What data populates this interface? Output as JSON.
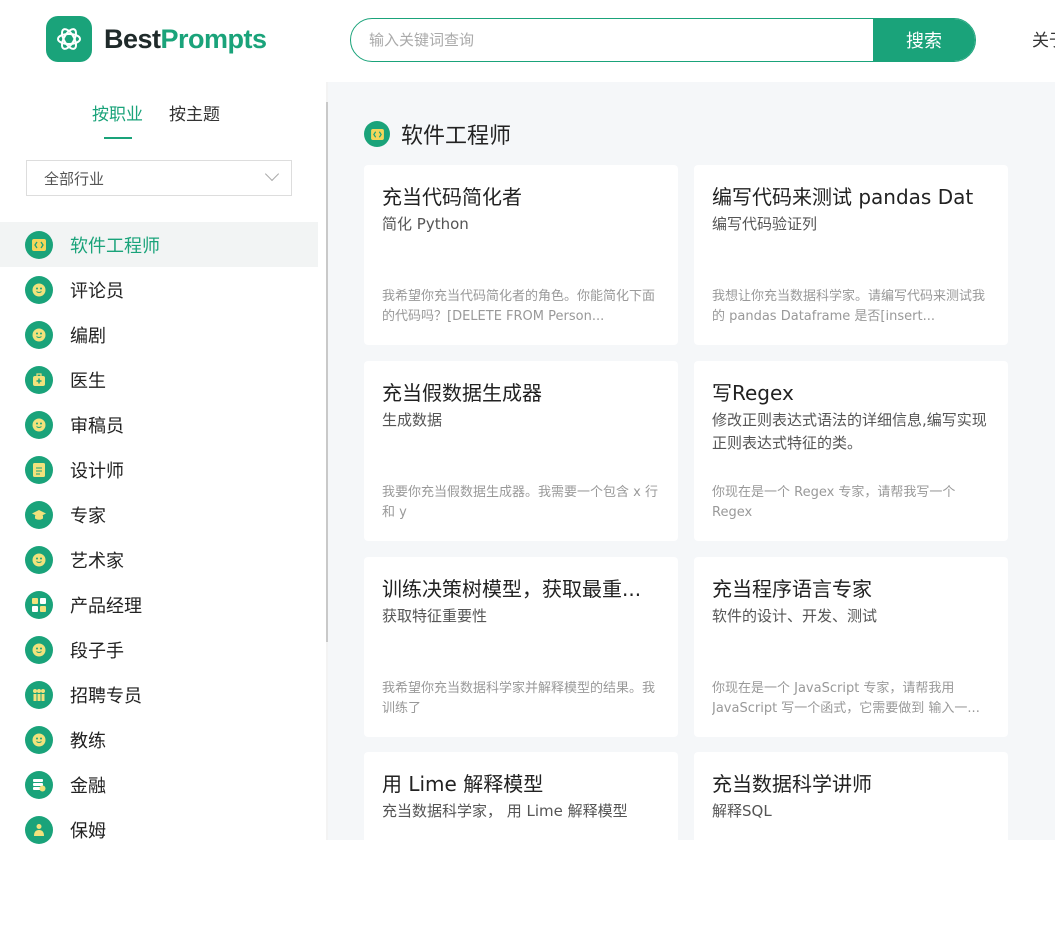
{
  "brand": {
    "part1": "Best",
    "part2": "Prompts",
    "accent": "#1aa37a"
  },
  "search": {
    "placeholder": "输入关键词查询",
    "button": "搜索"
  },
  "header": {
    "link": "关于"
  },
  "sidebar": {
    "tabs": [
      {
        "label": "按职业"
      },
      {
        "label": "按主题"
      }
    ],
    "select": {
      "value": "全部行业"
    },
    "categories": [
      {
        "label": "软件工程师",
        "icon": "code-icon"
      },
      {
        "label": "评论员",
        "icon": "smile-icon"
      },
      {
        "label": "编剧",
        "icon": "smile-icon"
      },
      {
        "label": "医生",
        "icon": "medkit-icon"
      },
      {
        "label": "审稿员",
        "icon": "smile-icon"
      },
      {
        "label": "设计师",
        "icon": "document-icon"
      },
      {
        "label": "专家",
        "icon": "graduation-cap-icon"
      },
      {
        "label": "艺术家",
        "icon": "smile-icon"
      },
      {
        "label": "产品经理",
        "icon": "grid-icon"
      },
      {
        "label": "段子手",
        "icon": "smile-icon"
      },
      {
        "label": "招聘专员",
        "icon": "people-icon"
      },
      {
        "label": "教练",
        "icon": "smile-icon"
      },
      {
        "label": "金融",
        "icon": "coins-icon"
      },
      {
        "label": "保姆",
        "icon": "person-icon"
      }
    ]
  },
  "main": {
    "section_title": "软件工程师",
    "cards": [
      {
        "title": "充当代码简化者",
        "subtitle": "简化 Python",
        "desc": "我希望你充当代码简化者的角色。你能简化下面的代码吗？[DELETE FROM Person..."
      },
      {
        "title": "编写代码来测试 pandas Dat",
        "subtitle": "编写代码验证列",
        "desc": "我想让你充当数据科学家。请编写代码来测试我的 pandas Dataframe 是否[insert..."
      },
      {
        "title": "充当假数据生成器",
        "subtitle": "生成数据",
        "desc": "我要你充当假数据生成器。我需要一个包含 x 行和 y"
      },
      {
        "title": "写Regex",
        "subtitle": "修改正则表达式语法的详细信息,编写实现正则表达式特征的类。",
        "desc": "你现在是一个 Regex 专家，请帮我写一个 Regex"
      },
      {
        "title": "训练决策树模型，获取最重...",
        "subtitle": "获取特征重要性",
        "desc": "我希望你充当数据科学家并解释模型的结果。我训练了"
      },
      {
        "title": "充当程序语言专家",
        "subtitle": "软件的设计、开发、测试",
        "desc": "你现在是一个 JavaScript 专家，请帮我用 JavaScript 写一个函式，它需要做到 输入一..."
      },
      {
        "title": "用 Lime 解释模型",
        "subtitle": "充当数据科学家， 用 Lime 解释模型",
        "desc": ""
      },
      {
        "title": "充当数据科学讲师",
        "subtitle": "解释SQL",
        "desc": ""
      }
    ]
  }
}
